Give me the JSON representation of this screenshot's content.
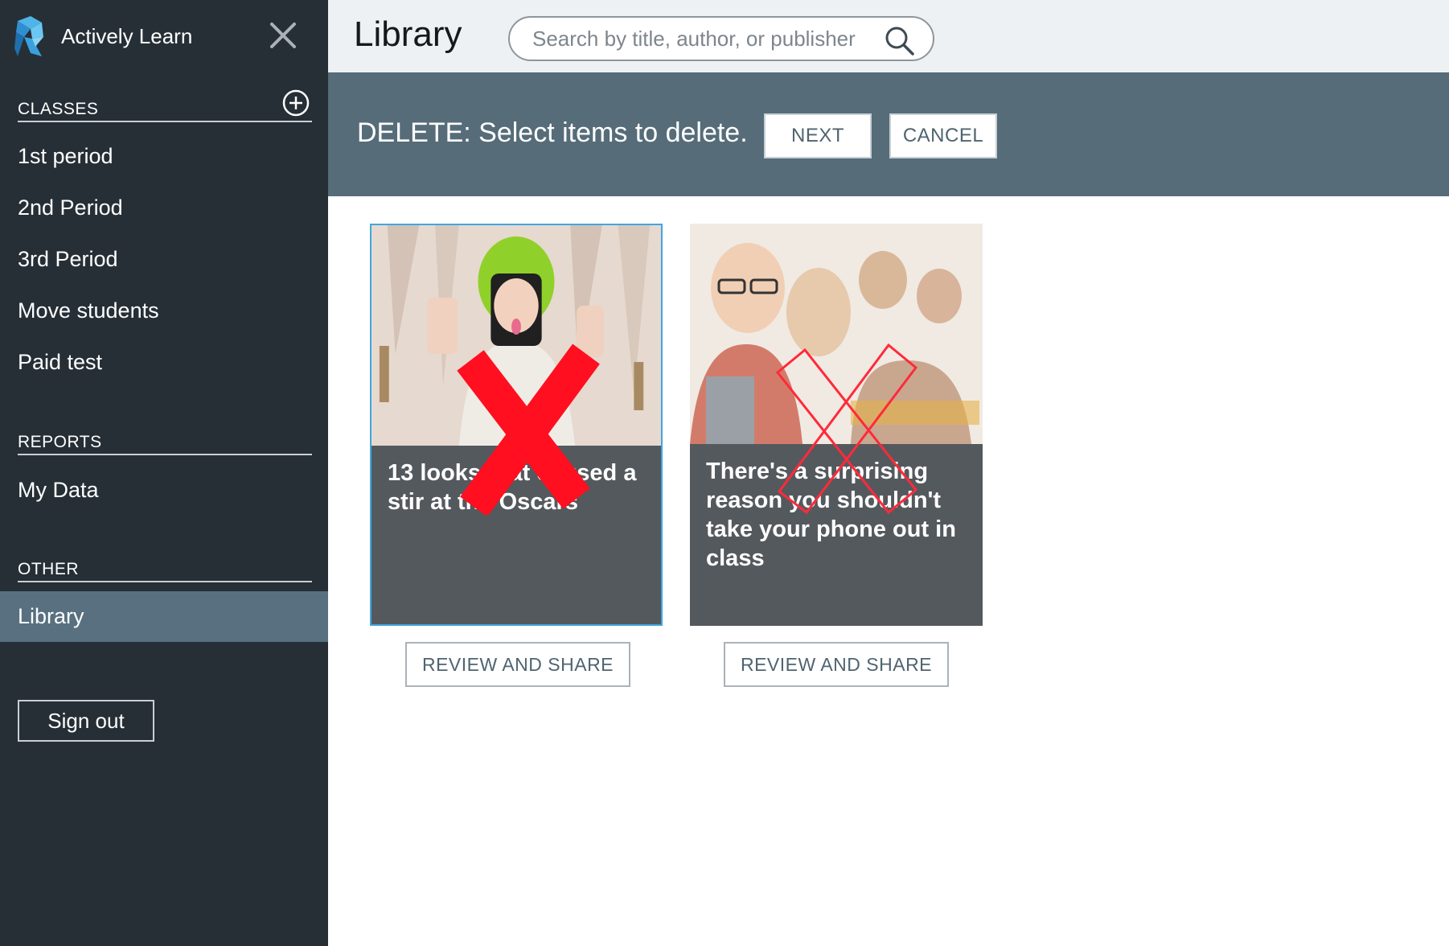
{
  "app": {
    "name": "Actively Learn",
    "logo_icon": "actively-learn-logo-icon",
    "close_icon": "close-icon"
  },
  "sidebar": {
    "classes_header": "CLASSES",
    "add_class_icon": "plus-circle-icon",
    "classes": [
      {
        "label": "1st period"
      },
      {
        "label": "2nd Period"
      },
      {
        "label": "3rd Period"
      },
      {
        "label": "Move students"
      },
      {
        "label": "Paid test"
      }
    ],
    "reports_header": "REPORTS",
    "reports": [
      {
        "label": "My Data"
      }
    ],
    "other_header": "OTHER",
    "other": [
      {
        "label": "Library",
        "active": true
      }
    ],
    "sign_out_label": "Sign out"
  },
  "header": {
    "title": "Library",
    "search_placeholder": "Search by title, author, or publisher",
    "search_value": "",
    "search_icon": "search-icon"
  },
  "delete_bar": {
    "message": "DELETE: Select items to delete.",
    "next_label": "NEXT",
    "cancel_label": "CANCEL"
  },
  "cards": [
    {
      "title": "13 looks that caused a stir at the Oscars",
      "selected": true,
      "mark_icon": "red-x-icon",
      "review_label": "REVIEW AND SHARE"
    },
    {
      "title": "There's a surprising reason you shouldn't take your phone out in class",
      "selected": false,
      "mark_icon": "outline-x-icon",
      "review_label": "REVIEW AND SHARE"
    }
  ],
  "colors": {
    "sidebar_bg": "#262f36",
    "sidebar_active": "#587080",
    "delete_bar_bg": "#566c79",
    "card_bg": "#54595e",
    "selection_border": "#42a5e0",
    "delete_mark": "#ff0f1f"
  }
}
